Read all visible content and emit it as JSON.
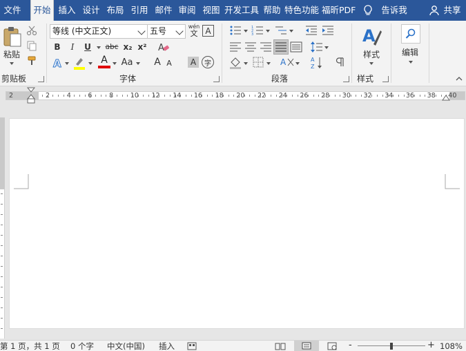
{
  "tabs": [
    {
      "label": "文件"
    },
    {
      "label": "开始"
    },
    {
      "label": "插入"
    },
    {
      "label": "设计"
    },
    {
      "label": "布局"
    },
    {
      "label": "引用"
    },
    {
      "label": "邮件"
    },
    {
      "label": "审阅"
    },
    {
      "label": "视图"
    },
    {
      "label": "开发工具"
    },
    {
      "label": "帮助"
    },
    {
      "label": "特色功能"
    },
    {
      "label": "福昕PDF"
    }
  ],
  "tell_me": "告诉我",
  "share": "共享",
  "ribbon": {
    "clipboard": {
      "paste_label": "粘贴",
      "group_label": "剪贴板"
    },
    "font": {
      "font_name": "等线 (中文正文)",
      "font_size": "五号",
      "bold": "B",
      "italic": "I",
      "underline": "U",
      "strike": "abc",
      "subscript": "x₂",
      "superscript": "x²",
      "font_color_glyph": "A",
      "case_glyph": "Aa",
      "grow_glyph": "A",
      "shrink_glyph": "A",
      "char_shade_glyph": "A",
      "enclose_glyph": "字",
      "phonetic_top": "wén",
      "phonetic_bottom": "文",
      "border_glyph": "A",
      "group_label": "字体"
    },
    "paragraph": {
      "group_label": "段落"
    },
    "styles": {
      "label": "样式",
      "group_label": "样式"
    },
    "editing": {
      "label": "编辑"
    }
  },
  "ruler": {
    "numbers": [
      "2",
      "2",
      "4",
      "6",
      "8",
      "10",
      "12",
      "14",
      "16",
      "18",
      "20",
      "22",
      "24",
      "26",
      "28",
      "30",
      "32",
      "34",
      "36",
      "38",
      "40"
    ]
  },
  "statusbar": {
    "page_info": "第 1 页，共 1 页",
    "word_count": "0 个字",
    "language": "中文(中国)",
    "insert_mode": "插入",
    "zoom_minus": "-",
    "zoom_plus": "+",
    "zoom": "108%"
  },
  "colors": {
    "brand": "#2b579a",
    "highlight": "#ffff00",
    "font_color": "#e00000"
  }
}
